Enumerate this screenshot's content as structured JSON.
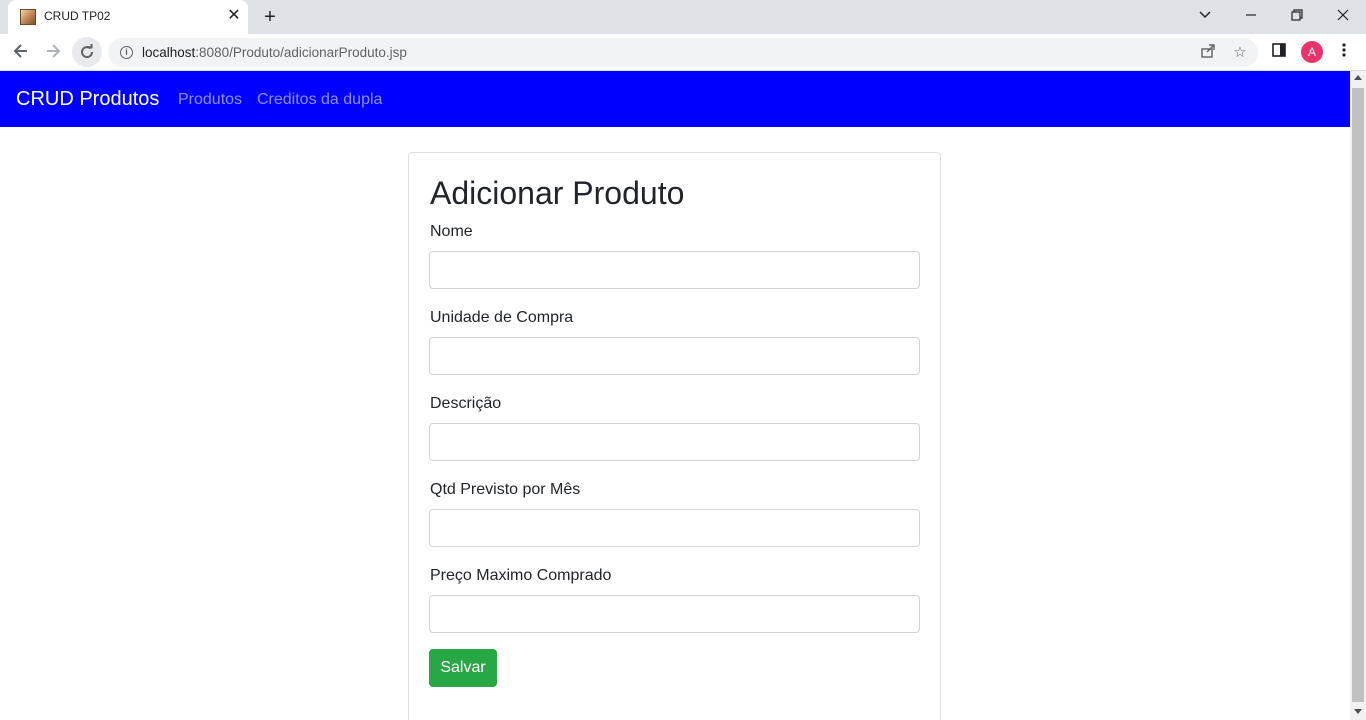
{
  "browser": {
    "tab_title": "CRUD TP02",
    "tab_close": "✕",
    "new_tab": "+",
    "url_host": "localhost",
    "url_rest": ":8080/Produto/adicionarProduto.jsp",
    "profile_initial": "A"
  },
  "navbar": {
    "brand": "CRUD Produtos",
    "links": [
      "Produtos",
      "Creditos da dupla"
    ],
    "background": "#0000ff"
  },
  "form": {
    "title": "Adicionar Produto",
    "fields": [
      {
        "label": "Nome",
        "value": ""
      },
      {
        "label": "Unidade de Compra",
        "value": ""
      },
      {
        "label": "Descrição",
        "value": ""
      },
      {
        "label": "Qtd Previsto por Mês",
        "value": ""
      },
      {
        "label": "Preço Maximo Comprado",
        "value": ""
      }
    ],
    "submit_label": "Salvar",
    "submit_color": "#28a745"
  }
}
